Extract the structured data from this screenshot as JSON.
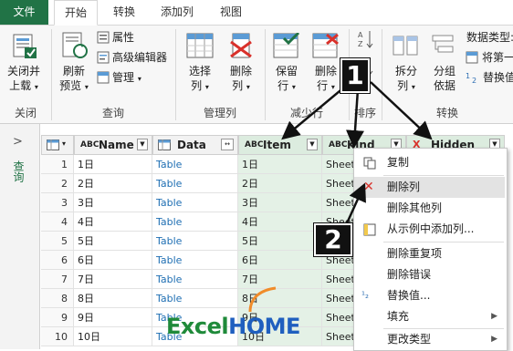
{
  "tabs": [
    {
      "label": "文件"
    },
    {
      "label": "开始"
    },
    {
      "label": "转换"
    },
    {
      "label": "添加列"
    },
    {
      "label": "视图"
    }
  ],
  "ribbon": {
    "close_group": {
      "btn1": "关闭并",
      "btn2": "上载",
      "label": "关闭"
    },
    "query_group": {
      "refresh1": "刷新",
      "refresh2": "预览",
      "properties": "属性",
      "advanced_editor": "高级编辑器",
      "manage": "管理",
      "label": "查询"
    },
    "manage_cols_group": {
      "select1": "选择",
      "select2": "列",
      "remove1": "删除",
      "remove2": "列",
      "label": "管理列"
    },
    "reduce_rows_group": {
      "keep1": "保留",
      "keep2": "行",
      "remove1": "删除",
      "remove2": "行",
      "label": "减少行"
    },
    "sort_group": {
      "label": "排序"
    },
    "transform_group": {
      "split1": "拆分",
      "split2": "列",
      "group1": "分组",
      "group2": "依据",
      "datatype": "数据类型:",
      "first_row": "将第一",
      "replace": "替换值",
      "label": "转换"
    }
  },
  "left_pane": {
    "label": "查询"
  },
  "grid": {
    "columns": [
      {
        "type_icon": "ABC",
        "name": "Name"
      },
      {
        "type_icon": "TABLE",
        "name": "Data"
      },
      {
        "type_icon": "ABC",
        "name": "Item"
      },
      {
        "type_icon": "ABC",
        "name": "Kind"
      },
      {
        "type_icon": "X",
        "name": "Hidden"
      }
    ],
    "rows": [
      {
        "n": "1",
        "name": "1日",
        "data": "Table",
        "item": "1日",
        "kind": "Sheet"
      },
      {
        "n": "2",
        "name": "2日",
        "data": "Table",
        "item": "2日",
        "kind": "Sheet"
      },
      {
        "n": "3",
        "name": "3日",
        "data": "Table",
        "item": "3日",
        "kind": "Sheet"
      },
      {
        "n": "4",
        "name": "4日",
        "data": "Table",
        "item": "4日",
        "kind": "Sheet"
      },
      {
        "n": "5",
        "name": "5日",
        "data": "Table",
        "item": "5日",
        "kind": "Sheet"
      },
      {
        "n": "6",
        "name": "6日",
        "data": "Table",
        "item": "6日",
        "kind": "Sheet"
      },
      {
        "n": "7",
        "name": "7日",
        "data": "Table",
        "item": "7日",
        "kind": "Sheet"
      },
      {
        "n": "8",
        "name": "8日",
        "data": "Table",
        "item": "8日",
        "kind": "Sheet"
      },
      {
        "n": "9",
        "name": "9日",
        "data": "Table",
        "item": "9日",
        "kind": "Sheet"
      },
      {
        "n": "10",
        "name": "10日",
        "data": "Table",
        "item": "10日",
        "kind": "Sheet"
      }
    ]
  },
  "context_menu": {
    "items": [
      {
        "label": "复制"
      },
      {
        "label": "删除列"
      },
      {
        "label": "删除其他列"
      },
      {
        "label": "从示例中添加列..."
      },
      {
        "label": "删除重复项"
      },
      {
        "label": "删除错误"
      },
      {
        "label": "替换值..."
      },
      {
        "label": "填充"
      },
      {
        "label": "更改类型"
      }
    ]
  },
  "annotations": {
    "badge1": "1",
    "badge2": "2"
  },
  "watermark": {
    "text1": "Excel",
    "text2": "HOME"
  },
  "colors": {
    "file_tab": "#217346",
    "accent_green": "#e4f1e6",
    "remove_red": "#d9312b"
  }
}
